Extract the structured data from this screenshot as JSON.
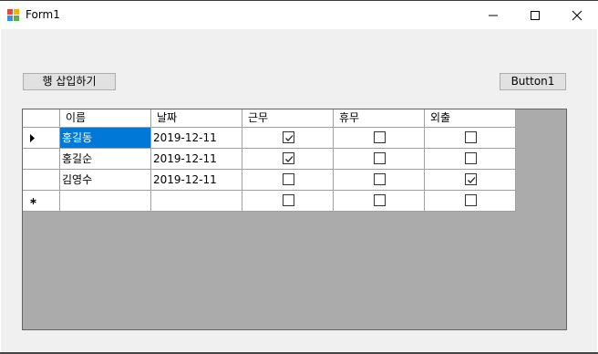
{
  "window": {
    "title": "Form1",
    "icon": "form-app-icon",
    "controls": [
      "minimize-icon",
      "maximize-icon",
      "close-icon"
    ]
  },
  "toolbar": {
    "insert_row_label": "행 삽입하기",
    "button1_label": "Button1"
  },
  "grid": {
    "columns": [
      "이름",
      "날짜",
      "근무",
      "휴무",
      "외출"
    ],
    "rows": [
      {
        "marker": "current-row-arrow",
        "name": "홍길동",
        "date": "2019-12-11",
        "work": true,
        "off": false,
        "out": false,
        "selected": true
      },
      {
        "marker": "",
        "name": "홍길순",
        "date": "2019-12-11",
        "work": true,
        "off": false,
        "out": false,
        "selected": false
      },
      {
        "marker": "",
        "name": "김영수",
        "date": "2019-12-11",
        "work": false,
        "off": false,
        "out": true,
        "selected": false
      },
      {
        "marker": "new-row-asterisk",
        "name": "",
        "date": "",
        "work": false,
        "off": false,
        "out": false,
        "selected": false
      }
    ],
    "colors": {
      "selection": "#0078d7",
      "background": "#ababab",
      "gridline": "#a0a0a0"
    }
  }
}
